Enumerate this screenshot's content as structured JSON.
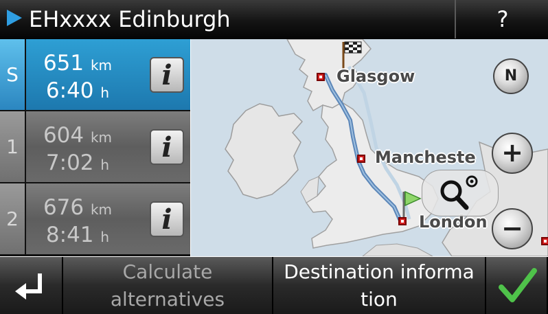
{
  "header": {
    "title": "EHxxxx Edinburgh",
    "help_label": "?"
  },
  "routes": [
    {
      "index": "S",
      "distance": "651",
      "distance_unit": "km",
      "time": "6:40",
      "time_unit": "h",
      "selected": true
    },
    {
      "index": "1",
      "distance": "604",
      "distance_unit": "km",
      "time": "7:02",
      "time_unit": "h",
      "selected": false
    },
    {
      "index": "2",
      "distance": "676",
      "distance_unit": "km",
      "time": "8:41",
      "time_unit": "h",
      "selected": false
    }
  ],
  "map": {
    "cities": [
      "Glasgow",
      "Mancheste",
      "London"
    ],
    "compass_label": "N",
    "zoom_in_label": "+",
    "zoom_out_label": "−",
    "route_color": "#5b86b8"
  },
  "toolbar": {
    "calculate_line1": "Calculate",
    "calculate_line2": "alternatives",
    "destination_line1": "Destination informa",
    "destination_line2": "tion"
  },
  "colors": {
    "accent_blue": "#2e9fd4",
    "confirm_green": "#4fc24a",
    "marker_red": "#d42020"
  }
}
